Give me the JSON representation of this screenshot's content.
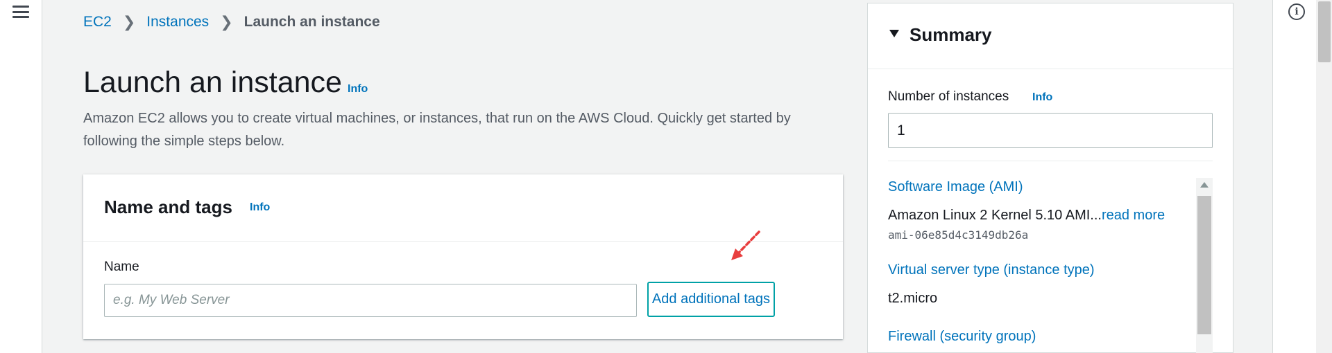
{
  "breadcrumb": {
    "items": [
      {
        "label": "EC2"
      },
      {
        "label": "Instances"
      }
    ],
    "current": "Launch an instance"
  },
  "page": {
    "title": "Launch an instance",
    "info_label": "Info",
    "description": "Amazon EC2 allows you to create virtual machines, or instances, that run on the AWS Cloud. Quickly get started by following the simple steps below."
  },
  "name_tags": {
    "title": "Name and tags",
    "info_label": "Info",
    "name_label": "Name",
    "name_placeholder": "e.g. My Web Server",
    "name_value": "",
    "add_tags_label": "Add additional tags"
  },
  "summary": {
    "title": "Summary",
    "num_instances_label": "Number of instances",
    "info_label": "Info",
    "num_instances_value": "1",
    "ami_label": "Software Image (AMI)",
    "ami_value": "Amazon Linux 2 Kernel 5.10 AMI...",
    "ami_read_more": "read more",
    "ami_id": "ami-06e85d4c3149db26a",
    "instance_type_label": "Virtual server type (instance type)",
    "instance_type_value": "t2.micro",
    "firewall_label": "Firewall (security group)"
  },
  "icons": {
    "menu": "hamburger-menu-icon",
    "collapse": "caret-down-icon",
    "help": "info-circle-icon",
    "annotation": "red-dashed-arrow"
  },
  "colors": {
    "link": "#0073bb",
    "button_border": "#00a1a6",
    "annotation": "#e83e3e",
    "background": "#f2f3f3"
  }
}
